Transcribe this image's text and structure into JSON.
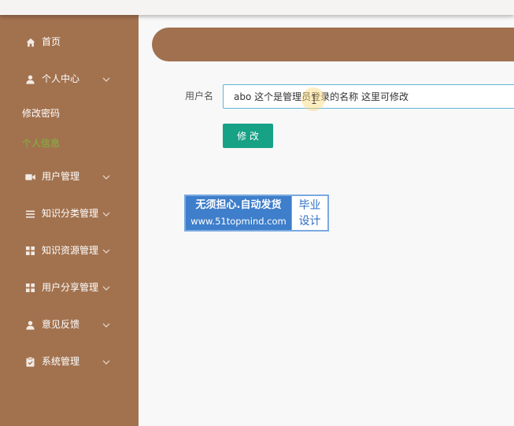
{
  "sidebar": {
    "items": [
      {
        "label": "首页",
        "icon": "home-icon"
      },
      {
        "label": "个人中心",
        "icon": "user-icon",
        "expanded": true,
        "children": [
          {
            "label": "修改密码",
            "active": false
          },
          {
            "label": "个人信息",
            "active": true
          }
        ]
      },
      {
        "label": "用户管理",
        "icon": "video-camera-icon"
      },
      {
        "label": "知识分类管理",
        "icon": "list-icon"
      },
      {
        "label": "知识资源管理",
        "icon": "grid-icon"
      },
      {
        "label": "用户分享管理",
        "icon": "grid-icon"
      },
      {
        "label": "意见反馈",
        "icon": "user-icon"
      },
      {
        "label": "系统管理",
        "icon": "clipboard-icon"
      }
    ]
  },
  "form": {
    "username_label": "用户名",
    "username_value": "abo 这个是管理员登录的名称 这里可修改",
    "submit_label": "修 改"
  },
  "watermark": {
    "slogan": "无须担心.自动发货",
    "website": "www.51topmind.com",
    "badge_line1": "毕业",
    "badge_line2": "设计"
  },
  "colors": {
    "sidebar_bg": "#a2724f",
    "banner_bg": "#a0704f",
    "active_item": "#7db93d",
    "button_bg": "#17a185",
    "input_border": "#63b3d3",
    "watermark_blue": "#3e7ecb"
  }
}
